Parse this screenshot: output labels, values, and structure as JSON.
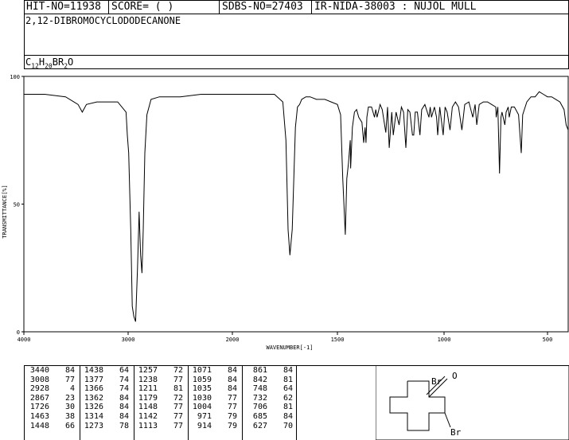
{
  "header": {
    "hit_no": "HIT-NO=11938",
    "score": "SCORE=  (   )",
    "sdbs_no": "SDBS-NO=27403",
    "ir_info": "IR-NIDA-38003 : NUJOL MULL"
  },
  "compound_name": "2,12-DIBROMOCYCLODODECANONE",
  "formula": {
    "c": "C",
    "c_n": "12",
    "h": "H",
    "h_n": "20",
    "br": "BR",
    "br_n": "2",
    "o": "O"
  },
  "chart_data": {
    "type": "line",
    "title": "",
    "xlabel": "WAVENUMBER[-1]",
    "ylabel": "TRANSMITTANCE[%]",
    "xlim": [
      4000,
      400
    ],
    "ylim": [
      0,
      100
    ],
    "x_ticks": [
      4000,
      3000,
      2000,
      1500,
      1000,
      500
    ],
    "y_ticks": [
      0,
      50,
      100
    ],
    "grid": false,
    "series": [
      {
        "x": [
          4000,
          3800,
          3600,
          3480,
          3440,
          3400,
          3300,
          3200,
          3100,
          3020,
          3008,
          2995,
          2975,
          2960,
          2945,
          2928,
          2910,
          2895,
          2880,
          2867,
          2855,
          2840,
          2820,
          2780,
          2700,
          2500,
          2300,
          2100,
          2000,
          1900,
          1800,
          1760,
          1745,
          1735,
          1726,
          1715,
          1700,
          1690,
          1680,
          1670,
          1650,
          1630,
          1600,
          1560,
          1530,
          1500,
          1485,
          1475,
          1463,
          1456,
          1448,
          1440,
          1438,
          1430,
          1420,
          1410,
          1400,
          1385,
          1377,
          1370,
          1366,
          1362,
          1355,
          1340,
          1326,
          1320,
          1314,
          1300,
          1290,
          1273,
          1265,
          1257,
          1245,
          1238,
          1225,
          1211,
          1200,
          1190,
          1179,
          1170,
          1160,
          1148,
          1142,
          1135,
          1125,
          1113,
          1105,
          1090,
          1071,
          1065,
          1059,
          1045,
          1035,
          1030,
          1020,
          1004,
          995,
          985,
          971,
          960,
          945,
          930,
          914,
          900,
          880,
          861,
          850,
          842,
          830,
          810,
          790,
          770,
          750,
          748,
          740,
          732,
          725,
          720,
          706,
          700,
          690,
          685,
          675,
          660,
          640,
          627,
          620,
          600,
          580,
          560,
          540,
          520,
          500,
          480,
          460,
          440,
          420,
          410,
          400
        ],
        "y": [
          93,
          93,
          92,
          89,
          86,
          89,
          90,
          90,
          90,
          86,
          77,
          70,
          40,
          10,
          6,
          4,
          25,
          47,
          30,
          23,
          40,
          70,
          85,
          91,
          92,
          92,
          93,
          93,
          93,
          93,
          93,
          90,
          75,
          40,
          30,
          40,
          80,
          88,
          89,
          91,
          92,
          92,
          91,
          91,
          90,
          89,
          85,
          60,
          38,
          60,
          66,
          75,
          64,
          80,
          86,
          87,
          84,
          82,
          74,
          80,
          74,
          84,
          88,
          88,
          84,
          87,
          84,
          89,
          87,
          78,
          88,
          72,
          86,
          77,
          86,
          81,
          88,
          86,
          72,
          87,
          86,
          77,
          77,
          86,
          86,
          77,
          87,
          89,
          84,
          88,
          84,
          88,
          84,
          77,
          88,
          77,
          88,
          86,
          79,
          88,
          90,
          88,
          79,
          89,
          90,
          84,
          89,
          81,
          89,
          90,
          90,
          89,
          88,
          84,
          88,
          62,
          84,
          86,
          81,
          86,
          88,
          84,
          88,
          88,
          85,
          70,
          85,
          90,
          92,
          92,
          94,
          93,
          92,
          92,
          91,
          90,
          87,
          81,
          79
        ]
      }
    ]
  },
  "peak_table": {
    "columns": [
      [
        [
          "3440",
          "84"
        ],
        [
          "3008",
          "77"
        ],
        [
          "2928",
          "4"
        ],
        [
          "2867",
          "23"
        ],
        [
          "1726",
          "30"
        ],
        [
          "1463",
          "38"
        ],
        [
          "1448",
          "66"
        ]
      ],
      [
        [
          "1438",
          "64"
        ],
        [
          "1377",
          "74"
        ],
        [
          "1366",
          "74"
        ],
        [
          "1362",
          "84"
        ],
        [
          "1326",
          "84"
        ],
        [
          "1314",
          "84"
        ],
        [
          "1273",
          "78"
        ]
      ],
      [
        [
          "1257",
          "72"
        ],
        [
          "1238",
          "77"
        ],
        [
          "1211",
          "81"
        ],
        [
          "1179",
          "72"
        ],
        [
          "1148",
          "77"
        ],
        [
          "1142",
          "77"
        ],
        [
          "1113",
          "77"
        ]
      ],
      [
        [
          "1071",
          "84"
        ],
        [
          "1059",
          "84"
        ],
        [
          "1035",
          "84"
        ],
        [
          "1030",
          "77"
        ],
        [
          "1004",
          "77"
        ],
        [
          "971",
          "79"
        ],
        [
          "914",
          "79"
        ]
      ],
      [
        [
          "861",
          "84"
        ],
        [
          "842",
          "81"
        ],
        [
          "748",
          "64"
        ],
        [
          "732",
          "62"
        ],
        [
          "706",
          "81"
        ],
        [
          "685",
          "84"
        ],
        [
          "627",
          "70"
        ]
      ]
    ]
  },
  "structure": {
    "atom_o": "O",
    "atom_br1": "Br",
    "atom_br2": "Br"
  }
}
